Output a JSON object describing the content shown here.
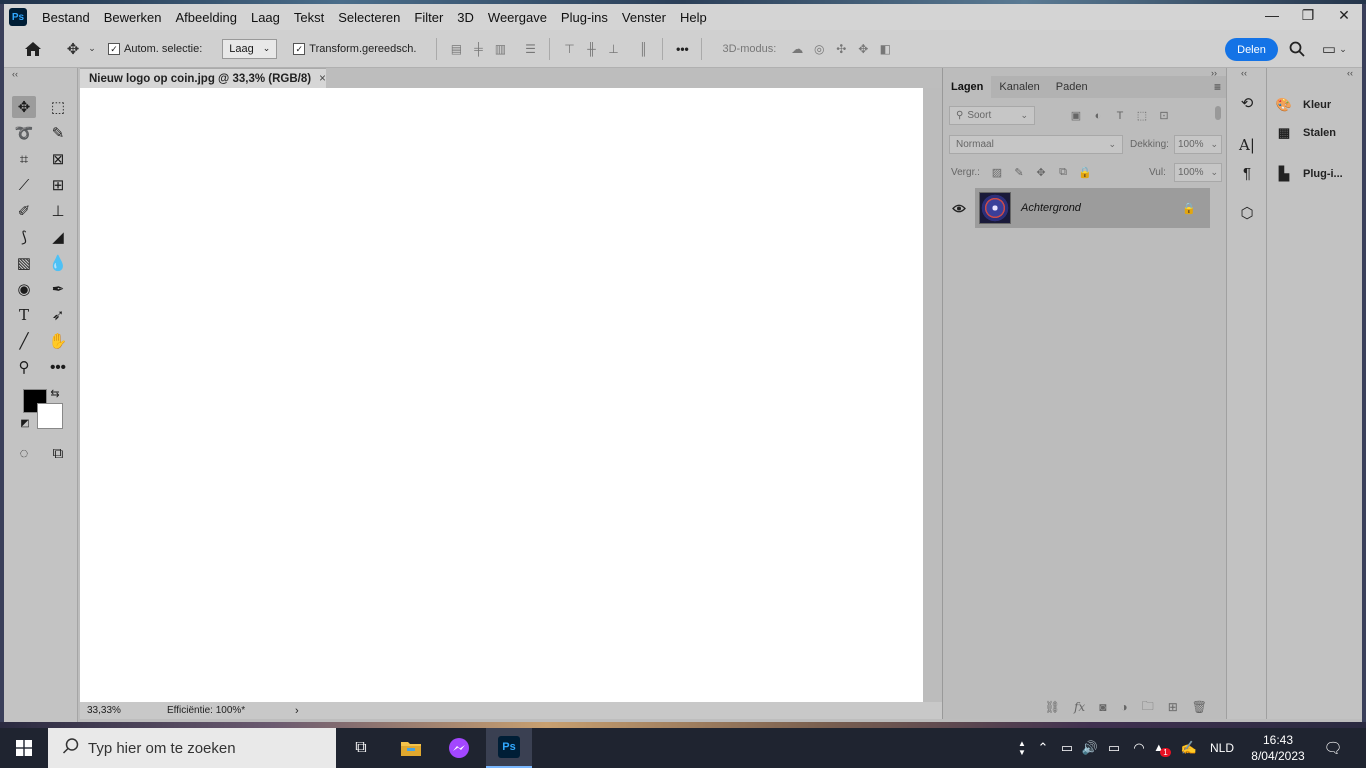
{
  "menubar": {
    "app_logo": "Ps",
    "items": [
      "Bestand",
      "Bewerken",
      "Afbeelding",
      "Laag",
      "Tekst",
      "Selecteren",
      "Filter",
      "3D",
      "Weergave",
      "Plug-ins",
      "Venster",
      "Help"
    ],
    "window_controls": {
      "minimize": "—",
      "maximize": "❐",
      "close": "✕"
    }
  },
  "options": {
    "auto_select_label": "Autom. selectie:",
    "auto_select_value": "Laag",
    "transform_label": "Transform.gereedsch.",
    "more_label": "•••",
    "mode_3d_label": "3D-modus:",
    "share_label": "Delen"
  },
  "document": {
    "tab_title": "Nieuw logo op coin.jpg @ 33,3% (RGB/8)",
    "zoom": "33,33%",
    "efficiency": "Efficiëntie: 100%*"
  },
  "layers_panel": {
    "tabs": [
      "Lagen",
      "Kanalen",
      "Paden"
    ],
    "filter_placeholder": "Soort",
    "blend_mode": "Normaal",
    "opacity_label": "Dekking:",
    "opacity_value": "100%",
    "lock_label": "Vergr.:",
    "fill_label": "Vul:",
    "fill_value": "100%",
    "layers": [
      {
        "name": "Achtergrond",
        "visible": true,
        "locked": true
      }
    ]
  },
  "right_dock": {
    "items": [
      "Kleur",
      "Stalen",
      "Plug-i..."
    ]
  },
  "taskbar": {
    "search_placeholder": "Typ hier om te zoeken",
    "active_app": "Ps",
    "language": "NLD",
    "time": "16:43",
    "date": "8/04/2023",
    "notification_badge": "1"
  },
  "colors": {
    "foreground": "#000000",
    "background": "#ffffff",
    "accent": "#1473e6"
  }
}
